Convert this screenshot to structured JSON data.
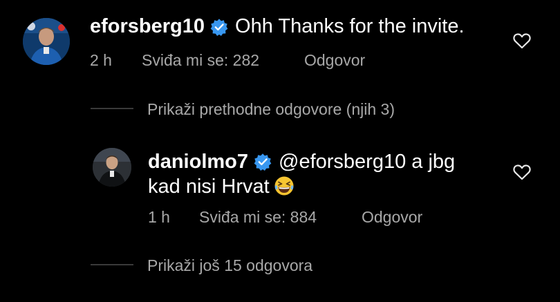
{
  "comment": {
    "username": "eforsberg10",
    "text": "Ohh Thanks for the invite.",
    "time": "2 h",
    "likes": "Sviđa mi se: 282",
    "reply": "Odgovor",
    "avatar": "avatar",
    "verified_icon": "verified-badge-icon",
    "like_icon": "heart-outline-icon"
  },
  "show_previous": "Prikaži prethodne odgovore (njih 3)",
  "reply": {
    "username": "daniolmo7",
    "mention": "@eforsberg10 a jbg",
    "text_line2": "kad nisi Hrvat",
    "emoji": "grinning-squinting-face-emoji",
    "time": "1 h",
    "likes": "Sviđa mi se: 884",
    "reply": "Odgovor",
    "avatar": "avatar",
    "verified_icon": "verified-badge-icon",
    "like_icon": "heart-outline-icon"
  },
  "show_more": "Prikaži još 15 odgovora",
  "colors": {
    "background": "#000000",
    "text": "#ffffff",
    "secondary": "#a8a8a8",
    "verified": "#3897f0",
    "connector": "#3a3a3a"
  }
}
